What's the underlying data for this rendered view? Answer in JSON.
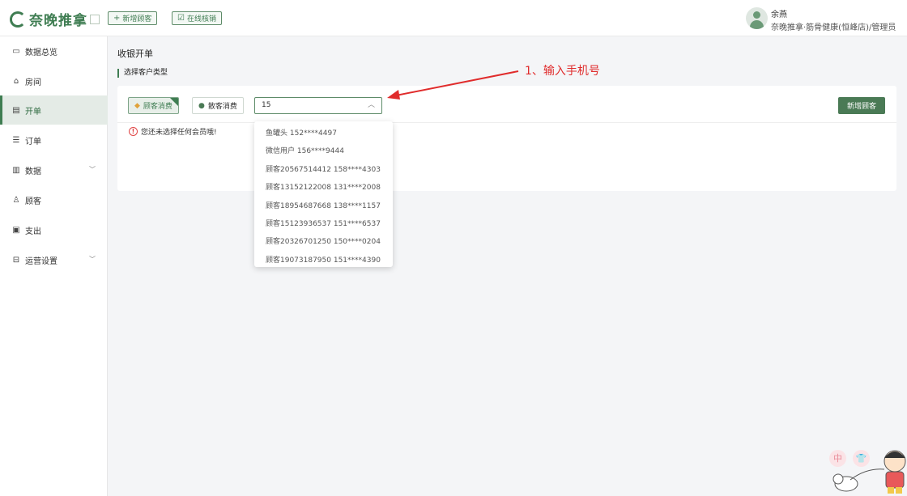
{
  "header": {
    "logo_text": "奈晚推拿",
    "buttons": [
      {
        "icon": "+",
        "label": "新增顾客"
      },
      {
        "icon": "☑",
        "label": "在线核销"
      }
    ],
    "user_name": "余燕",
    "user_role": "奈晚推拿·筋骨健康(恒峰店)/管理员"
  },
  "sidebar": {
    "items": [
      {
        "label": "数据总览",
        "icon": "monitor-icon",
        "glyph": "▭"
      },
      {
        "label": "房间",
        "icon": "home-icon",
        "glyph": "⌂"
      },
      {
        "label": "开单",
        "icon": "document-icon",
        "glyph": "▤"
      },
      {
        "label": "订单",
        "icon": "list-icon",
        "glyph": "☰"
      },
      {
        "label": "数据",
        "icon": "chart-icon",
        "glyph": "▥"
      },
      {
        "label": "顾客",
        "icon": "user-icon",
        "glyph": "♙"
      },
      {
        "label": "支出",
        "icon": "wallet-icon",
        "glyph": "▣"
      },
      {
        "label": "运营设置",
        "icon": "settings-icon",
        "glyph": "⊟"
      }
    ],
    "active_index": 2
  },
  "main": {
    "page_title": "收银开单",
    "section_label": "选择客户类型",
    "type_buttons": [
      {
        "label": "顾客消费",
        "icon": "diamond-icon",
        "selected": true
      },
      {
        "label": "散客消费",
        "icon": "user-icon",
        "selected": false
      }
    ],
    "search_value": "15",
    "add_customer_label": "新增顾客",
    "warning": "您还未选择任何会员哦!"
  },
  "dropdown": {
    "options": [
      "鱼罐头 152****4497",
      "微信用户 156****9444",
      "顾客20567514412 158****4303",
      "顾客13152122008 131****2008",
      "顾客18954687668 138****1157",
      "顾客15123936537 151****6537",
      "顾客20326701250 150****0204",
      "顾客19073187950 151****4390"
    ]
  },
  "annotation": {
    "text": "1、输入手机号",
    "color": "#e02c2c"
  },
  "widgets": [
    "中",
    "👕"
  ],
  "colors": {
    "accent": "#3f7d52",
    "button": "#4a7a55",
    "warning": "#e04646"
  }
}
